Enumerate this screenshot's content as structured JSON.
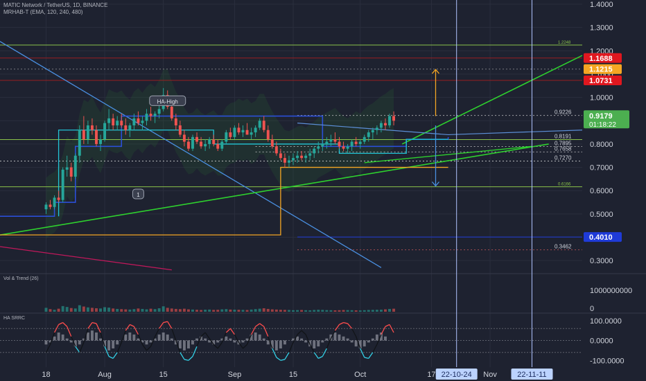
{
  "header": {
    "symbol_line": "MATIC Network / TetherUS, 1D, BINANCE",
    "indicator_line": "MRHAB-T (EMA, 120, 240, 480)"
  },
  "colors": {
    "background": "#1e2230",
    "up": "#26a69a",
    "down": "#ef5350",
    "price_green": "#4caf50",
    "red_label": "#e0171f",
    "orange": "#f5a623",
    "blue_line": "#2b4fd8",
    "cyan_line": "#22c5d6",
    "trend_green": "#2ed12e",
    "diag_blue": "#4a90e2",
    "macd_cyan": "#33d0e6",
    "macd_red": "#ff4d4d"
  },
  "chart_data": {
    "type": "candlestick",
    "symbol": "MATIC Network / TetherUS, 1D, BINANCE",
    "indicator": "MRHAB-T (EMA, 120, 240, 480)",
    "ylim": [
      0.25,
      1.4
    ],
    "y_ticks": [
      "1.4000",
      "1.3000",
      "1.2000",
      "1.1000",
      "1.0000",
      "0.9000",
      "0.8000",
      "0.7000",
      "0.6000",
      "0.5000",
      "0.4000",
      "0.3000"
    ],
    "x_ticks": [
      "18",
      "Aug",
      "15",
      "Sep",
      "15",
      "Oct",
      "17",
      "Nov"
    ],
    "x_tick_days": [
      0,
      14,
      28,
      45,
      59,
      75,
      92,
      106
    ],
    "x_range_days": [
      -11,
      128
    ],
    "last_day": 98,
    "candles_ohlc": [
      [
        0.52,
        0.55,
        0.5,
        0.54
      ],
      [
        0.54,
        0.56,
        0.52,
        0.53
      ],
      [
        0.53,
        0.58,
        0.52,
        0.57
      ],
      [
        0.57,
        0.6,
        0.55,
        0.56
      ],
      [
        0.56,
        0.7,
        0.55,
        0.69
      ],
      [
        0.69,
        0.75,
        0.66,
        0.7
      ],
      [
        0.7,
        0.72,
        0.64,
        0.66
      ],
      [
        0.66,
        0.76,
        0.65,
        0.75
      ],
      [
        0.75,
        0.88,
        0.72,
        0.86
      ],
      [
        0.86,
        0.92,
        0.8,
        0.82
      ],
      [
        0.82,
        0.9,
        0.8,
        0.88
      ],
      [
        0.88,
        0.91,
        0.84,
        0.86
      ],
      [
        0.86,
        0.88,
        0.79,
        0.8
      ],
      [
        0.8,
        0.84,
        0.77,
        0.82
      ],
      [
        0.82,
        0.9,
        0.81,
        0.89
      ],
      [
        0.89,
        0.95,
        0.86,
        0.91
      ],
      [
        0.91,
        0.93,
        0.86,
        0.88
      ],
      [
        0.88,
        0.92,
        0.86,
        0.9
      ],
      [
        0.9,
        0.93,
        0.87,
        0.88
      ],
      [
        0.88,
        0.91,
        0.84,
        0.86
      ],
      [
        0.86,
        0.89,
        0.83,
        0.88
      ],
      [
        0.88,
        0.93,
        0.86,
        0.91
      ],
      [
        0.91,
        0.94,
        0.88,
        0.89
      ],
      [
        0.89,
        0.92,
        0.86,
        0.9
      ],
      [
        0.9,
        0.95,
        0.88,
        0.93
      ],
      [
        0.93,
        0.96,
        0.9,
        0.92
      ],
      [
        0.92,
        0.94,
        0.89,
        0.93
      ],
      [
        0.93,
        0.98,
        0.91,
        0.95
      ],
      [
        0.95,
        1.04,
        0.94,
        1.01
      ],
      [
        1.01,
        1.03,
        0.95,
        0.96
      ],
      [
        0.96,
        0.98,
        0.9,
        0.91
      ],
      [
        0.91,
        0.93,
        0.86,
        0.88
      ],
      [
        0.88,
        0.9,
        0.83,
        0.84
      ],
      [
        0.84,
        0.86,
        0.79,
        0.81
      ],
      [
        0.81,
        0.83,
        0.77,
        0.78
      ],
      [
        0.78,
        0.84,
        0.77,
        0.83
      ],
      [
        0.83,
        0.85,
        0.8,
        0.81
      ],
      [
        0.81,
        0.83,
        0.78,
        0.79
      ],
      [
        0.79,
        0.82,
        0.77,
        0.8
      ],
      [
        0.8,
        0.83,
        0.78,
        0.82
      ],
      [
        0.82,
        0.84,
        0.79,
        0.8
      ],
      [
        0.8,
        0.82,
        0.77,
        0.78
      ],
      [
        0.78,
        0.82,
        0.77,
        0.81
      ],
      [
        0.81,
        0.86,
        0.8,
        0.85
      ],
      [
        0.85,
        0.87,
        0.82,
        0.83
      ],
      [
        0.83,
        0.88,
        0.82,
        0.87
      ],
      [
        0.87,
        0.89,
        0.84,
        0.85
      ],
      [
        0.85,
        0.88,
        0.83,
        0.86
      ],
      [
        0.86,
        0.89,
        0.84,
        0.84
      ],
      [
        0.84,
        0.87,
        0.82,
        0.85
      ],
      [
        0.85,
        0.88,
        0.83,
        0.87
      ],
      [
        0.87,
        0.91,
        0.86,
        0.9
      ],
      [
        0.9,
        0.92,
        0.85,
        0.86
      ],
      [
        0.86,
        0.88,
        0.81,
        0.82
      ],
      [
        0.82,
        0.84,
        0.78,
        0.79
      ],
      [
        0.79,
        0.81,
        0.75,
        0.76
      ],
      [
        0.76,
        0.78,
        0.73,
        0.74
      ],
      [
        0.74,
        0.76,
        0.7,
        0.72
      ],
      [
        0.72,
        0.75,
        0.7,
        0.73
      ],
      [
        0.73,
        0.76,
        0.71,
        0.74
      ],
      [
        0.74,
        0.77,
        0.72,
        0.75
      ],
      [
        0.75,
        0.77,
        0.73,
        0.74
      ],
      [
        0.74,
        0.76,
        0.72,
        0.75
      ],
      [
        0.75,
        0.78,
        0.73,
        0.76
      ],
      [
        0.76,
        0.79,
        0.74,
        0.78
      ],
      [
        0.78,
        0.81,
        0.76,
        0.79
      ],
      [
        0.79,
        0.82,
        0.77,
        0.8
      ],
      [
        0.8,
        0.83,
        0.78,
        0.81
      ],
      [
        0.81,
        0.84,
        0.79,
        0.82
      ],
      [
        0.82,
        0.85,
        0.8,
        0.81
      ],
      [
        0.81,
        0.83,
        0.78,
        0.79
      ],
      [
        0.79,
        0.81,
        0.77,
        0.78
      ],
      [
        0.78,
        0.8,
        0.76,
        0.79
      ],
      [
        0.79,
        0.82,
        0.77,
        0.81
      ],
      [
        0.81,
        0.83,
        0.79,
        0.8
      ],
      [
        0.8,
        0.82,
        0.78,
        0.81
      ],
      [
        0.81,
        0.84,
        0.8,
        0.83
      ],
      [
        0.83,
        0.86,
        0.81,
        0.85
      ],
      [
        0.85,
        0.87,
        0.82,
        0.86
      ],
      [
        0.86,
        0.88,
        0.84,
        0.87
      ],
      [
        0.87,
        0.9,
        0.85,
        0.89
      ],
      [
        0.89,
        0.91,
        0.86,
        0.88
      ],
      [
        0.88,
        0.93,
        0.87,
        0.92
      ],
      [
        0.92,
        0.94,
        0.88,
        0.9
      ]
    ],
    "levels": [
      {
        "label": "1.2248",
        "value": 1.2248
      },
      {
        "label": "0.9226",
        "value": 0.9226
      },
      {
        "label": "0.8191",
        "value": 0.8191
      },
      {
        "label": "0.7895",
        "value": 0.7895
      },
      {
        "label": "0.7658",
        "value": 0.7658
      },
      {
        "label": "0.7270",
        "value": 0.727
      },
      {
        "label": "0.6166",
        "value": 0.6166
      },
      {
        "label": "0.3462",
        "value": 0.3462
      }
    ],
    "price_labels": [
      {
        "text": "1.1688",
        "value": 1.1688,
        "color": "#e0171f"
      },
      {
        "text": "1.1215",
        "value": 1.1215,
        "color": "#f5a623"
      },
      {
        "text": "1.0731",
        "value": 1.0731,
        "color": "#e0171f"
      },
      {
        "text": "0.4010",
        "value": 0.401,
        "color": "#1f3bd8"
      }
    ],
    "current_price": {
      "value": 0.9179,
      "text": "0.9179",
      "countdown": "01:18:22"
    },
    "callouts": [
      {
        "text": "HA-High",
        "day": 29,
        "price": 0.98
      },
      {
        "text": "1",
        "day": 22,
        "price": 0.58
      }
    ],
    "date_labels": [
      {
        "text": "22-10-24",
        "day": 98
      },
      {
        "text": "22-11-11",
        "day": 116
      }
    ],
    "volume": {
      "title": "Vol & Trend (26)",
      "tick_labels": [
        "1000000000",
        "0"
      ],
      "ylim": [
        0,
        1600000000
      ],
      "bars": [
        180,
        120,
        90,
        140,
        260,
        220,
        170,
        150,
        300,
        240,
        200,
        180,
        160,
        150,
        210,
        190,
        150,
        130,
        120,
        110,
        100,
        120,
        150,
        130,
        110,
        140,
        120,
        160,
        250,
        180,
        150,
        130,
        120,
        140,
        110,
        100,
        90,
        80,
        95,
        100,
        85,
        90,
        110,
        120,
        100,
        95,
        90,
        85,
        80,
        100,
        120,
        140,
        160,
        130,
        110,
        100,
        90,
        85,
        80,
        70,
        75,
        80,
        70,
        65,
        80,
        90,
        85,
        75,
        70,
        65,
        70,
        80,
        75,
        70,
        65,
        60,
        70,
        80,
        85,
        90,
        95,
        110,
        130,
        140
      ],
      "bars_unit_millions": true
    },
    "oscillator": {
      "title": "HA SRRC",
      "tick_labels": [
        "100.0000",
        "0.0000",
        "-100.0000"
      ],
      "ylim": [
        -120,
        120
      ],
      "line": [
        -60,
        -20,
        40,
        80,
        90,
        70,
        20,
        -30,
        -60,
        -10,
        60,
        90,
        85,
        40,
        -30,
        -80,
        -90,
        -60,
        -10,
        50,
        80,
        70,
        30,
        -20,
        -50,
        -30,
        20,
        60,
        90,
        95,
        60,
        0,
        -60,
        -95,
        -100,
        -80,
        -30,
        20,
        40,
        10,
        -20,
        -40,
        -10,
        40,
        60,
        30,
        -10,
        -40,
        -20,
        30,
        70,
        85,
        70,
        20,
        -40,
        -85,
        -100,
        -95,
        -60,
        -10,
        30,
        50,
        30,
        -20,
        -60,
        -90,
        -80,
        -40,
        10,
        50,
        80,
        90,
        85,
        60,
        20,
        -40,
        -85,
        -90,
        -60,
        -20,
        30,
        70,
        80,
        40
      ],
      "bars": [
        -20,
        -10,
        20,
        40,
        30,
        10,
        -10,
        -30,
        -20,
        10,
        40,
        50,
        40,
        10,
        -30,
        -50,
        -40,
        -20,
        0,
        30,
        40,
        30,
        10,
        -10,
        -20,
        -10,
        10,
        30,
        40,
        30,
        10,
        -20,
        -40,
        -50,
        -40,
        -20,
        10,
        20,
        10,
        -10,
        -20,
        -10,
        10,
        20,
        10,
        -10,
        -20,
        -10,
        10,
        30,
        40,
        30,
        10,
        -20,
        -40,
        -50,
        -40,
        -20,
        0,
        10,
        20,
        10,
        -10,
        -30,
        -40,
        -30,
        -10,
        10,
        30,
        40,
        30,
        20,
        10,
        -10,
        -30,
        -40,
        -30,
        -10,
        10,
        30,
        40,
        20
      ]
    }
  }
}
